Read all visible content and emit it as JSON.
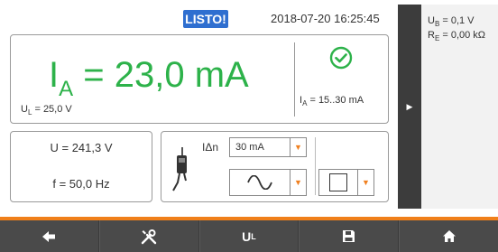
{
  "header": {
    "status": "LISTO!",
    "datetime": "2018-07-20 16:25:45"
  },
  "main_result": {
    "symbol": "I",
    "symbol_sub": "A",
    "equals_value": " = 23,0 mA",
    "ul_label": "U",
    "ul_sub": "L",
    "ul_value": " = 25,0 V",
    "range_label": "I",
    "range_sub": "A",
    "range_value": " = 15..30 mA",
    "ok_icon": "check-circle-icon"
  },
  "mains": {
    "voltage": "U = 241,3 V",
    "frequency": "f = 50,0 Hz"
  },
  "settings": {
    "idn_label": "IΔn",
    "current_value": "30 mA",
    "waveform_icon": "sine-wave-icon",
    "type_icon": "square-box-icon"
  },
  "results_panel": {
    "ub_label": "U",
    "ub_sub": "B",
    "ub_value": " = 0,1 V",
    "re_label": "R",
    "re_sub": "E",
    "re_value": " = 0,00 kΩ"
  },
  "toolbar": {
    "back_icon": "arrow-left-icon",
    "tools_icon": "tools-icon",
    "ul_label": "U",
    "ul_sub": "L",
    "save_icon": "floppy-disk-icon",
    "home_icon": "home-icon"
  },
  "colors": {
    "accent_orange": "#f07f1a",
    "result_green": "#2db24a",
    "badge_blue": "#2f6fd0"
  }
}
